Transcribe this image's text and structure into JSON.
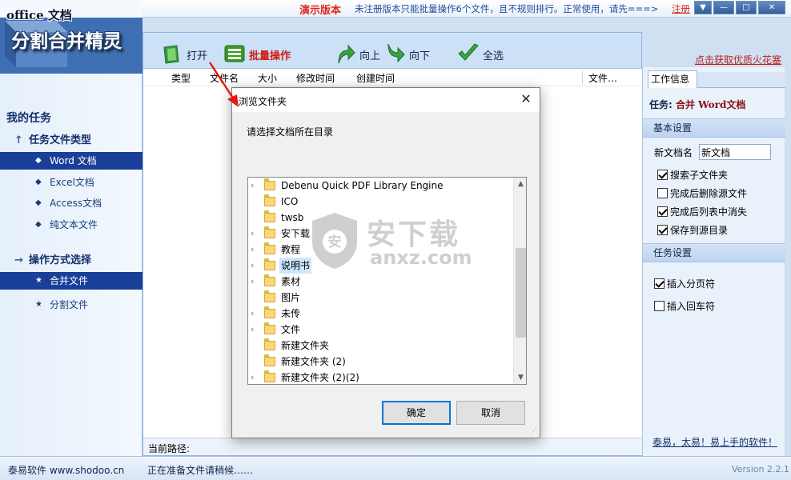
{
  "app": {
    "logo_sub": "office 文档",
    "logo_main": "分割合并精灵",
    "demo_label": "演示版本",
    "demo_note": "未注册版本只能批量操作6个文件，且不规则排行。正常使用，请先===>",
    "register_link": "注册"
  },
  "toolbar": {
    "open": "打开",
    "batch": "批量操作",
    "up": "向上",
    "down": "向下",
    "select_all": "全选"
  },
  "promo_link": "点击获取优质火花塞",
  "sidebar": {
    "title": "我的任务",
    "file_type_header": "任务文件类型",
    "file_types": [
      {
        "label": "Word 文档",
        "selected": true
      },
      {
        "label": "Excel文档",
        "selected": false
      },
      {
        "label": "Access文档",
        "selected": false
      },
      {
        "label": "纯文本文件",
        "selected": false
      }
    ],
    "operation_header": "操作方式选择",
    "operations": [
      {
        "label": "合并文件",
        "selected": true
      },
      {
        "label": "分割文件",
        "selected": false
      }
    ]
  },
  "file_list": {
    "columns": [
      "类型",
      "文件名",
      "大小",
      "修改时间",
      "创建时间",
      "文件…"
    ],
    "rows": []
  },
  "path_label": "当前路径:",
  "right_panel": {
    "tab": "工作信息",
    "task_prefix": "任务:",
    "task_name": "合并 Word文档",
    "basic_settings": "基本设置",
    "new_name_label": "新文档名",
    "new_name_value": "新文档",
    "basic_options": [
      {
        "label": "搜索子文件夹",
        "checked": true
      },
      {
        "label": "完成后删除源文件",
        "checked": false
      },
      {
        "label": "完成后列表中消失",
        "checked": true
      },
      {
        "label": "保存到源目录",
        "checked": true
      }
    ],
    "task_settings": "任务设置",
    "task_options": [
      {
        "label": "插入分页符",
        "checked": true
      },
      {
        "label": "插入回车符",
        "checked": false
      }
    ],
    "slogan": "泰易，太易！易上手的软件！"
  },
  "dialog": {
    "title": "浏览文件夹",
    "prompt": "请选择文档所在目录",
    "folders": [
      {
        "name": "Debenu Quick PDF Library Engine",
        "expandable": true,
        "selected": false
      },
      {
        "name": "ICO",
        "expandable": false,
        "selected": false
      },
      {
        "name": "twsb",
        "expandable": false,
        "selected": false
      },
      {
        "name": "安下载",
        "expandable": true,
        "selected": false
      },
      {
        "name": "教程",
        "expandable": true,
        "selected": false
      },
      {
        "name": "说明书",
        "expandable": true,
        "selected": true
      },
      {
        "name": "素材",
        "expandable": true,
        "selected": false
      },
      {
        "name": "图片",
        "expandable": false,
        "selected": false
      },
      {
        "name": "未传",
        "expandable": true,
        "selected": false
      },
      {
        "name": "文件",
        "expandable": true,
        "selected": false
      },
      {
        "name": "新建文件夹",
        "expandable": false,
        "selected": false
      },
      {
        "name": "新建文件夹 (2)",
        "expandable": false,
        "selected": false
      },
      {
        "name": "新建文件夹 (2)(2)",
        "expandable": true,
        "selected": false
      }
    ],
    "ok": "确定",
    "cancel": "取消"
  },
  "watermark": {
    "text": "安下载",
    "url": "anxz.com"
  },
  "status": {
    "company": "泰易软件 www.shodoo.cn",
    "message": "正在准备文件请稍候……",
    "version": "Version 2.2.1"
  },
  "colors": {
    "accent_red": "#e0261c",
    "nav_selected": "#1a3f99",
    "panel_bg": "#e9f1fb"
  }
}
